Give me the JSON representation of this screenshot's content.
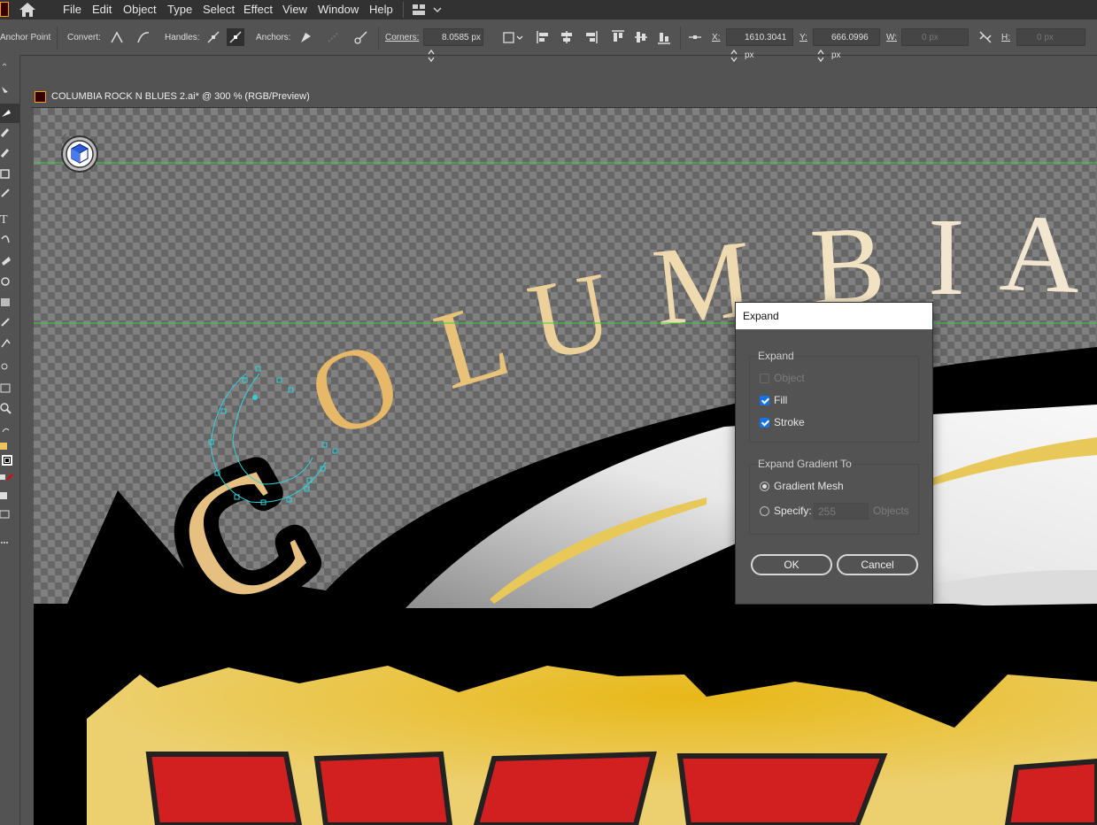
{
  "menubar": {
    "items": [
      "File",
      "Edit",
      "Object",
      "Type",
      "Select",
      "Effect",
      "View",
      "Window",
      "Help"
    ]
  },
  "controlbar": {
    "tool_label": "Anchor Point",
    "convert_label": "Convert:",
    "handles_label": "Handles:",
    "anchors_label": "Anchors:",
    "corners_label": "Corners:",
    "corners_value": "8.0585 px",
    "x_label": "X:",
    "x_value": "1610.3041 px",
    "y_label": "Y:",
    "y_value": "666.0996 px",
    "w_label": "W:",
    "w_value": "0 px",
    "h_label": "H:",
    "h_value": "0 px"
  },
  "document": {
    "tab_title": "COLUMBIA ROCK N BLUES 2.ai* @ 300 % (RGB/Preview)",
    "artwork_text": "COLUMBI"
  },
  "dialog": {
    "title": "Expand",
    "expand_group": "Expand",
    "object_label": "Object",
    "fill_label": "Fill",
    "stroke_label": "Stroke",
    "gradient_group": "Expand Gradient To",
    "gradient_mesh_label": "Gradient Mesh",
    "specify_label": "Specify:",
    "specify_value": "255",
    "objects_label": "Objects",
    "ok_label": "OK",
    "cancel_label": "Cancel",
    "state": {
      "object": false,
      "fill": true,
      "stroke": true,
      "gradient_to": "Gradient Mesh"
    }
  },
  "colors": {
    "guide": "#3cd23c",
    "path_selection": "#31d0d8",
    "accent": "#1473e6"
  }
}
